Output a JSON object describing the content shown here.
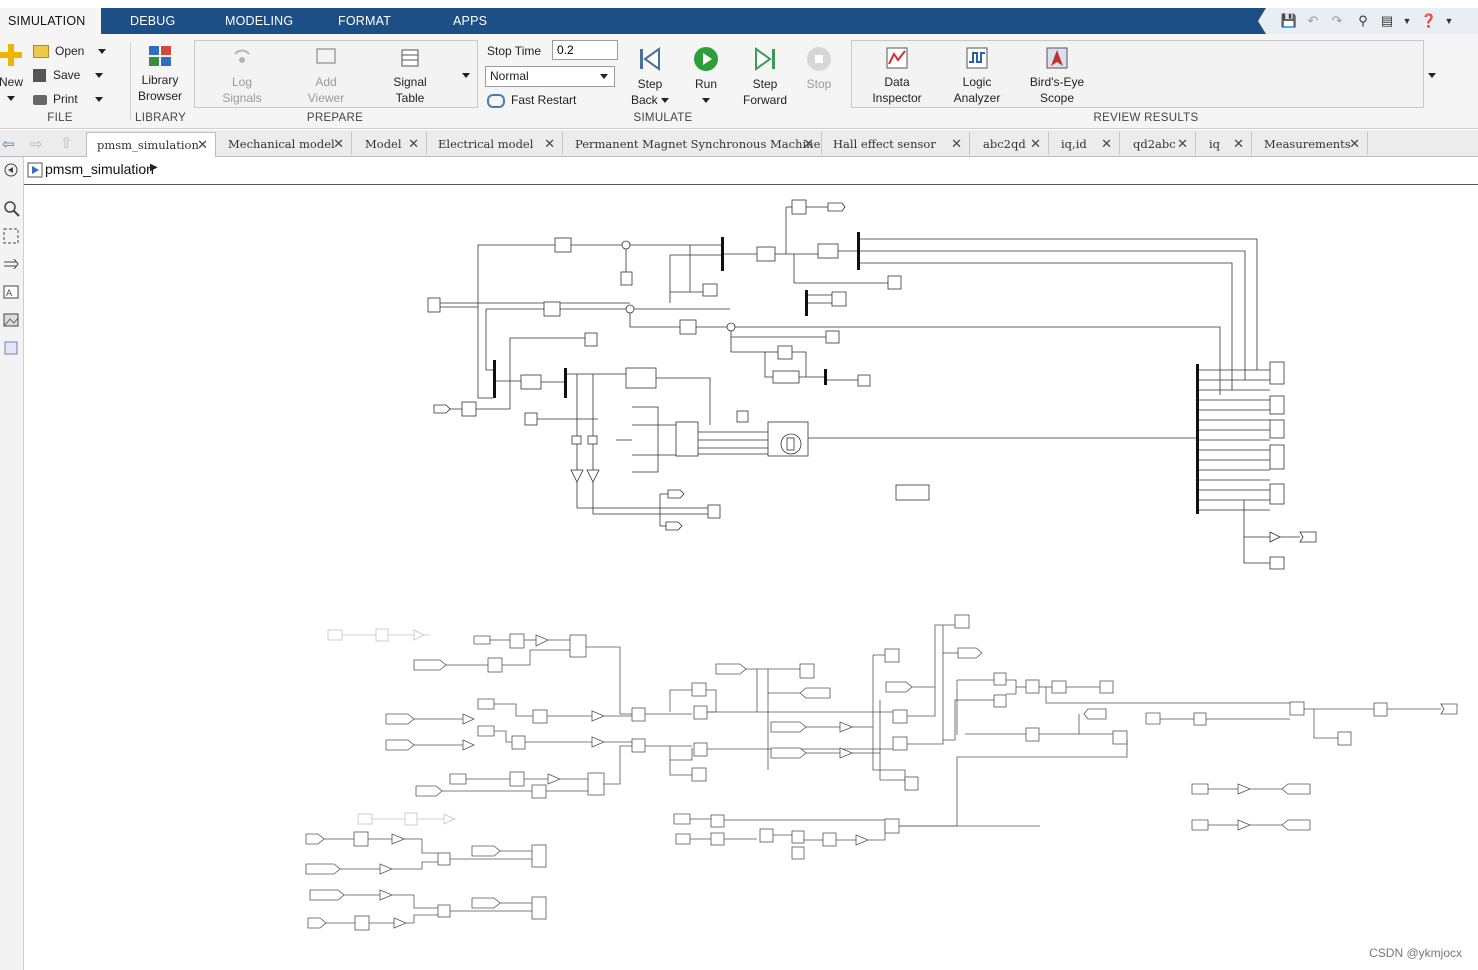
{
  "menu": {
    "tabs": [
      "SIMULATION",
      "DEBUG",
      "MODELING",
      "FORMAT",
      "APPS"
    ]
  },
  "file": {
    "new": "New",
    "open": "Open",
    "save": "Save",
    "print": "Print",
    "label": "FILE"
  },
  "library": {
    "browser_l1": "Library",
    "browser_l2": "Browser",
    "label": "LIBRARY"
  },
  "prepare": {
    "log_l1": "Log",
    "log_l2": "Signals",
    "add_l1": "Add",
    "add_l2": "Viewer",
    "table_l1": "Signal",
    "table_l2": "Table",
    "label": "PREPARE"
  },
  "simulate": {
    "stop_time_label": "Stop Time",
    "stop_time_value": "0.2",
    "mode": "Normal",
    "fast_restart": "Fast Restart",
    "step_back_l1": "Step",
    "step_back_l2": "Back",
    "run": "Run",
    "step_fwd_l1": "Step",
    "step_fwd_l2": "Forward",
    "stop": "Stop",
    "label": "SIMULATE"
  },
  "review": {
    "di_l1": "Data",
    "di_l2": "Inspector",
    "la_l1": "Logic",
    "la_l2": "Analyzer",
    "be_l1": "Bird's-Eye",
    "be_l2": "Scope",
    "label": "REVIEW RESULTS"
  },
  "doc_tabs": [
    "pmsm_simulation",
    "Mechanical model",
    "Model",
    "Electrical model",
    "Permanent Magnet Synchronous Machine",
    "Hall effect sensor",
    "abc2qd",
    "iq,id",
    "qd2abc",
    "iq",
    "Measurements"
  ],
  "breadcrumb": {
    "model": "pmsm_simulation"
  },
  "watermark": "CSDN @ykmjocx",
  "colors": {
    "menu_bar": "#1b4f86",
    "ribbon": "#f5f5f5",
    "run_green": "#2e9e3a",
    "canvas": "#ffffff"
  }
}
